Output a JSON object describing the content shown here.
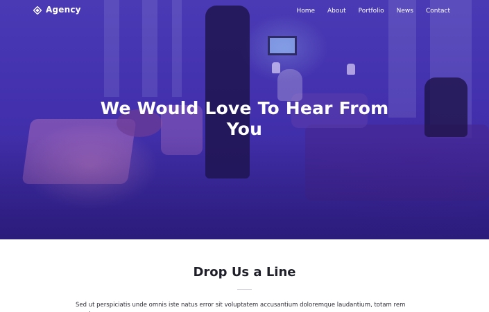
{
  "brand": {
    "name": "Agency",
    "icon": "diamond-logo-icon"
  },
  "nav": {
    "items": [
      {
        "label": "Home"
      },
      {
        "label": "About"
      },
      {
        "label": "Portfolio"
      },
      {
        "label": "News"
      },
      {
        "label": "Contact"
      }
    ]
  },
  "hero": {
    "title": "We Would Love To Hear From You",
    "overlay_color": "#3f2fa6"
  },
  "section": {
    "title": "Drop Us a Line",
    "paragraph": "Sed ut perspiciatis unde omnis iste natus error sit voluptatem accusantium doloremque laudantium, totam rem aperiam, eaque"
  }
}
